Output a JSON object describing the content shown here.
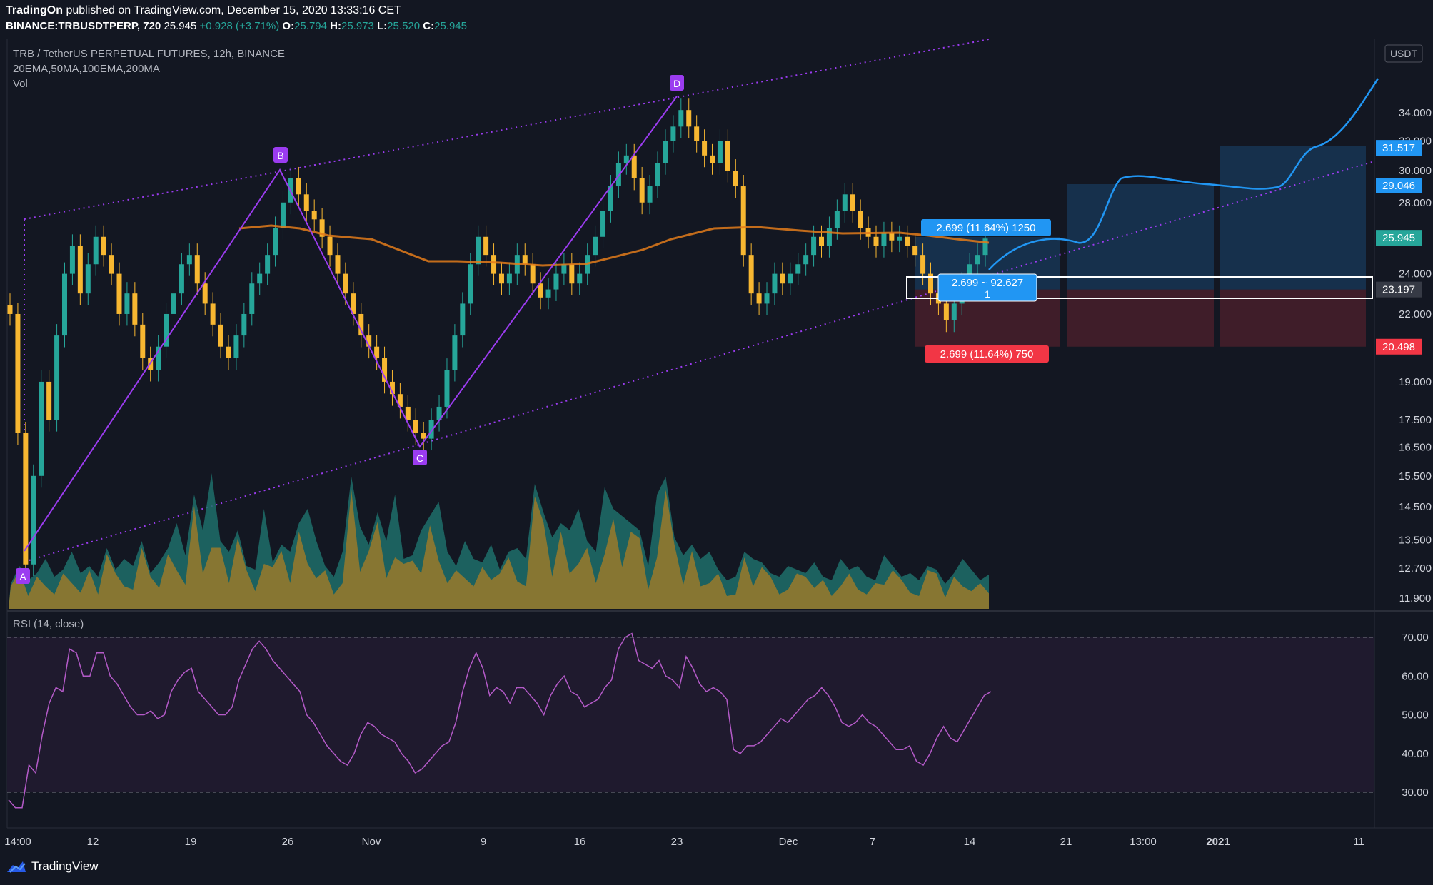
{
  "header": {
    "publisher": "TradingOn",
    "published_text": "published on TradingView.com, December 15, 2020 13:33:16 CET",
    "symbol": "BINANCE:TRBUSDTPERP, 720",
    "last": "25.945",
    "change": "+0.928 (+3.71%)",
    "o_label": "O:",
    "o": "25.794",
    "h_label": "H:",
    "h": "25.973",
    "l_label": "L:",
    "l": "25.520",
    "c_label": "C:",
    "c": "25.945"
  },
  "legend": {
    "title": "TRB / TetherUS PERPETUAL FUTURES, 12h, BINANCE",
    "mas": "20EMA,50MA,100EMA,200MA",
    "vol": "Vol",
    "rsi": "RSI (14, close)"
  },
  "currency": "USDT",
  "footer": {
    "brand": "TradingView"
  },
  "colors": {
    "bg": "#131722",
    "up": "#26a69a",
    "down": "#f7b731",
    "ema": "#e37b1a",
    "pattern": "#9b3cf0",
    "projection": "#2196f3",
    "target": "#2196f3",
    "stop": "#f23645"
  },
  "chart_data": {
    "type": "candlestick",
    "symbol": "TRBUSDTPERP",
    "interval": "12h",
    "y_ticks": [
      34.0,
      32.0,
      30.0,
      28.0,
      24.0,
      22.0,
      19.0,
      17.5,
      16.5,
      15.5,
      14.5,
      13.5,
      12.7,
      11.9
    ],
    "y_tick_labels": [
      "34.000",
      "32.000",
      "30.000",
      "28.000",
      "24.000",
      "22.000",
      "19.000",
      "17.500",
      "16.500",
      "15.500",
      "14.500",
      "13.500",
      "12.700",
      "11.900"
    ],
    "price_tags": [
      {
        "label": "31.517",
        "value": 31.517,
        "color": "#2196f3"
      },
      {
        "label": "29.046",
        "value": 29.046,
        "color": "#2196f3"
      },
      {
        "label": "25.945",
        "value": 25.945,
        "color": "#26a69a"
      },
      {
        "label": "23.197",
        "value": 23.197,
        "color": "#363a45"
      },
      {
        "label": "20.498",
        "value": 20.498,
        "color": "#f23645"
      }
    ],
    "x_tick_labels": [
      "14:00",
      "12",
      "19",
      "26",
      "Nov",
      "9",
      "16",
      "23",
      "Dec",
      "7",
      "14",
      "21",
      "13:00",
      "2021",
      "11"
    ],
    "pattern_points": [
      {
        "label": "A",
        "price": 12.9
      },
      {
        "label": "B",
        "price": 29.8
      },
      {
        "label": "C",
        "price": 16.6
      },
      {
        "label": "D",
        "price": 34.9
      }
    ],
    "position": {
      "target_label": "2.699 (11.64%) 1250",
      "stop_label": "2.699 (11.64%) 750",
      "ratio_label": "2.699 ~ 92.627",
      "ratio_sub": "1",
      "entry": 23.197,
      "target": 25.896,
      "stop": 20.498
    },
    "rsi": {
      "levels": [
        70,
        30
      ],
      "y_tick_labels": [
        "70.00",
        "60.00",
        "50.00",
        "40.00",
        "30.00"
      ],
      "values": [
        28,
        26,
        26,
        37,
        35,
        45,
        53,
        57,
        56,
        67,
        66,
        60,
        60,
        66,
        66,
        60,
        58,
        55,
        52,
        50,
        50,
        51,
        49,
        50,
        56,
        59,
        61,
        62,
        56,
        54,
        52,
        50,
        50,
        52,
        59,
        63,
        67,
        69,
        67,
        64,
        62,
        60,
        58,
        56,
        50,
        48,
        45,
        42,
        40,
        38,
        37,
        40,
        45,
        48,
        47,
        45,
        44,
        43,
        40,
        38,
        35,
        36,
        38,
        40,
        42,
        43,
        48,
        56,
        62,
        66,
        62,
        55,
        57,
        56,
        53,
        57,
        57,
        55,
        53,
        50,
        55,
        58,
        60,
        56,
        55,
        52,
        53,
        54,
        57,
        59,
        67,
        70,
        71,
        64,
        63,
        62,
        64,
        60,
        59,
        57,
        65,
        62,
        58,
        56,
        57,
        56,
        54,
        41,
        40,
        42,
        42,
        43,
        45,
        47,
        49,
        48,
        50,
        52,
        54,
        55,
        57,
        55,
        52,
        48,
        47,
        48,
        50,
        48,
        47,
        45,
        43,
        41,
        41,
        42,
        38,
        37,
        40,
        44,
        47,
        44,
        43,
        46,
        49,
        52,
        55,
        56
      ],
      "ylim": [
        25,
        73
      ]
    },
    "ylim": [
      11.6,
      36.5
    ]
  }
}
